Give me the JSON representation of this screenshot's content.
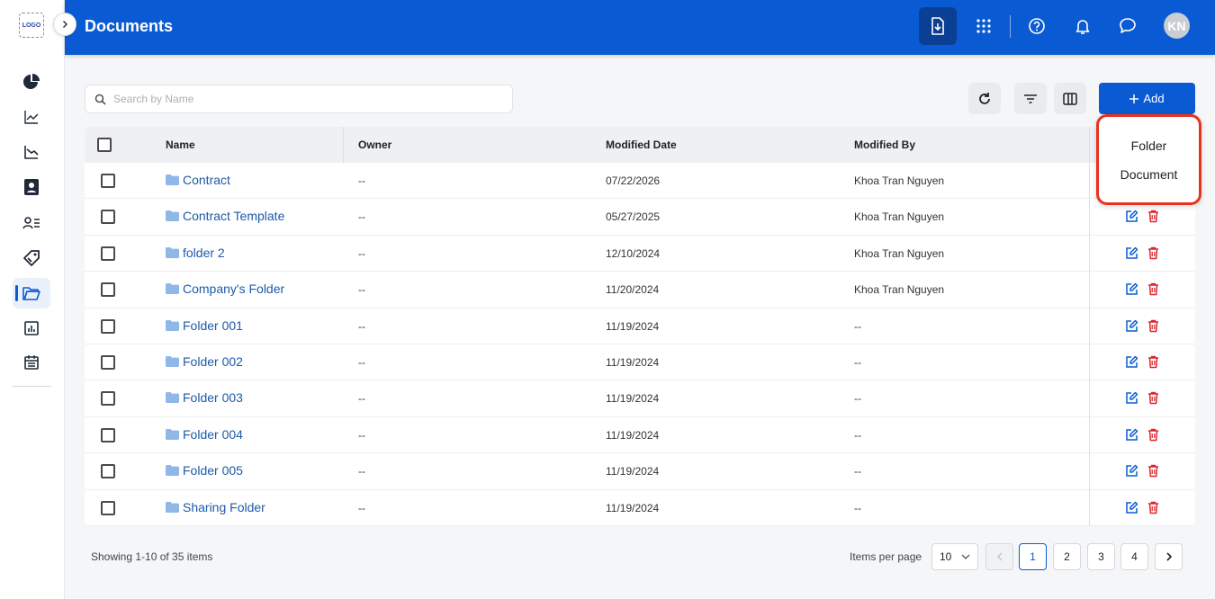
{
  "brand": {
    "logo_text": "LOGO"
  },
  "header": {
    "title": "Documents",
    "avatar_initials": "KN",
    "icons": [
      "download-document-icon",
      "apps-grid-icon",
      "help-icon",
      "bell-icon",
      "chat-icon"
    ]
  },
  "sidebar": {
    "items": [
      {
        "name": "dashboard",
        "icon": "pie-chart-icon"
      },
      {
        "name": "analytics",
        "icon": "trend-line-icon"
      },
      {
        "name": "reports",
        "icon": "line-chart-icon"
      },
      {
        "name": "contacts",
        "icon": "contact-card-icon"
      },
      {
        "name": "users",
        "icon": "user-list-icon"
      },
      {
        "name": "deals",
        "icon": "tag-icon"
      },
      {
        "name": "documents",
        "icon": "folder-open-icon",
        "active": true
      },
      {
        "name": "statistics",
        "icon": "bar-chart-icon"
      },
      {
        "name": "calendar",
        "icon": "calendar-icon"
      }
    ]
  },
  "toolbar": {
    "search_placeholder": "Search by Name",
    "add_label": "Add",
    "add_menu": [
      "Folder",
      "Document"
    ]
  },
  "table": {
    "columns": [
      "Name",
      "Owner",
      "Modified Date",
      "Modified By"
    ],
    "rows": [
      {
        "name": "Contract",
        "owner": "--",
        "modified_date": "07/22/2026",
        "modified_by": "Khoa Tran Nguyen"
      },
      {
        "name": "Contract Template",
        "owner": "--",
        "modified_date": "05/27/2025",
        "modified_by": "Khoa Tran Nguyen"
      },
      {
        "name": "folder 2",
        "owner": "--",
        "modified_date": "12/10/2024",
        "modified_by": "Khoa Tran Nguyen"
      },
      {
        "name": "Company's Folder",
        "owner": "--",
        "modified_date": "11/20/2024",
        "modified_by": "Khoa Tran Nguyen"
      },
      {
        "name": "Folder 001",
        "owner": "--",
        "modified_date": "11/19/2024",
        "modified_by": "--"
      },
      {
        "name": "Folder 002",
        "owner": "--",
        "modified_date": "11/19/2024",
        "modified_by": "--"
      },
      {
        "name": "Folder 003",
        "owner": "--",
        "modified_date": "11/19/2024",
        "modified_by": "--"
      },
      {
        "name": "Folder 004",
        "owner": "--",
        "modified_date": "11/19/2024",
        "modified_by": "--"
      },
      {
        "name": "Folder 005",
        "owner": "--",
        "modified_date": "11/19/2024",
        "modified_by": "--"
      },
      {
        "name": "Sharing Folder",
        "owner": "--",
        "modified_date": "11/19/2024",
        "modified_by": "--"
      }
    ]
  },
  "footer": {
    "showing_text": "Showing 1-10 of 35 items",
    "items_per_page_label": "Items per page",
    "items_per_page_value": "10",
    "pages": [
      "1",
      "2",
      "3",
      "4"
    ],
    "current_page": "1"
  },
  "colors": {
    "primary": "#0a5bd3",
    "header_active": "#0a3f94",
    "link": "#1d5aa8",
    "delete": "#d9262b",
    "highlight": "#e8321d"
  }
}
